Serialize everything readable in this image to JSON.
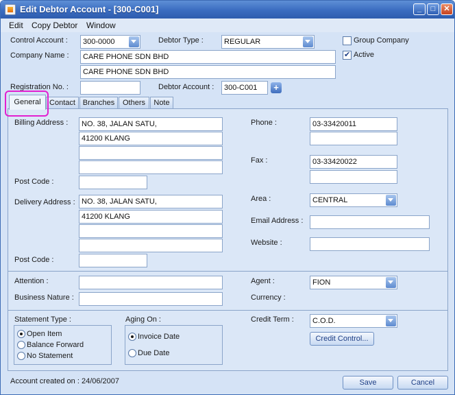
{
  "window": {
    "title": "Edit Debtor Account - [300-C001]"
  },
  "menu": [
    "Edit",
    "Copy Debtor",
    "Window"
  ],
  "header": {
    "control_account_label": "Control Account :",
    "control_account_value": "300-0000",
    "debtor_type_label": "Debtor Type :",
    "debtor_type_value": "REGULAR",
    "group_company_label": "Group Company",
    "group_company_checked": false,
    "active_label": "Active",
    "active_checked": true,
    "company_name_label": "Company Name :",
    "company_name_1": "CARE PHONE SDN BHD",
    "company_name_2": "CARE PHONE SDN BHD",
    "registration_label": "Registration No. :",
    "registration_value": "",
    "debtor_account_label": "Debtor Account :",
    "debtor_account_value": "300-C001"
  },
  "tabs": [
    {
      "label": "General",
      "active": true
    },
    {
      "label": "Contact",
      "active": false
    },
    {
      "label": "Branches",
      "active": false
    },
    {
      "label": "Others",
      "active": false
    },
    {
      "label": "Note",
      "active": false
    }
  ],
  "general": {
    "billing_address_label": "Billing Address :",
    "billing_address": [
      "NO. 38, JALAN SATU,",
      "41200 KLANG",
      "",
      ""
    ],
    "billing_post_code_label": "Post Code :",
    "billing_post_code": "",
    "delivery_address_label": "Delivery Address :",
    "delivery_address": [
      "NO. 38, JALAN SATU,",
      "41200 KLANG",
      "",
      ""
    ],
    "delivery_post_code_label": "Post Code :",
    "delivery_post_code": "",
    "phone_label": "Phone :",
    "phone_1": "03-33420011",
    "phone_2": "",
    "fax_label": "Fax :",
    "fax_1": "03-33420022",
    "fax_2": "",
    "area_label": "Area :",
    "area_value": "CENTRAL",
    "email_label": "Email  Address :",
    "email_value": "",
    "website_label": "Website :",
    "website_value": "",
    "attention_label": "Attention :",
    "attention_value": "",
    "business_nature_label": "Business Nature :",
    "business_nature_value": "",
    "agent_label": "Agent :",
    "agent_value": "FION",
    "currency_label": "Currency :",
    "statement_type_label": "Statement Type :",
    "statement_options": [
      {
        "label": "Open Item",
        "selected": true
      },
      {
        "label": "Balance Forward",
        "selected": false
      },
      {
        "label": "No Statement",
        "selected": false
      }
    ],
    "aging_on_label": "Aging On :",
    "aging_options": [
      {
        "label": "Invoice Date",
        "selected": true
      },
      {
        "label": "Due Date",
        "selected": false
      }
    ],
    "credit_term_label": "Credit Term :",
    "credit_term_value": "C.O.D.",
    "credit_control_button": "Credit Control..."
  },
  "footer": {
    "account_created_text": "Account created on :  24/06/2007",
    "save_button": "Save",
    "cancel_button": "Cancel"
  }
}
